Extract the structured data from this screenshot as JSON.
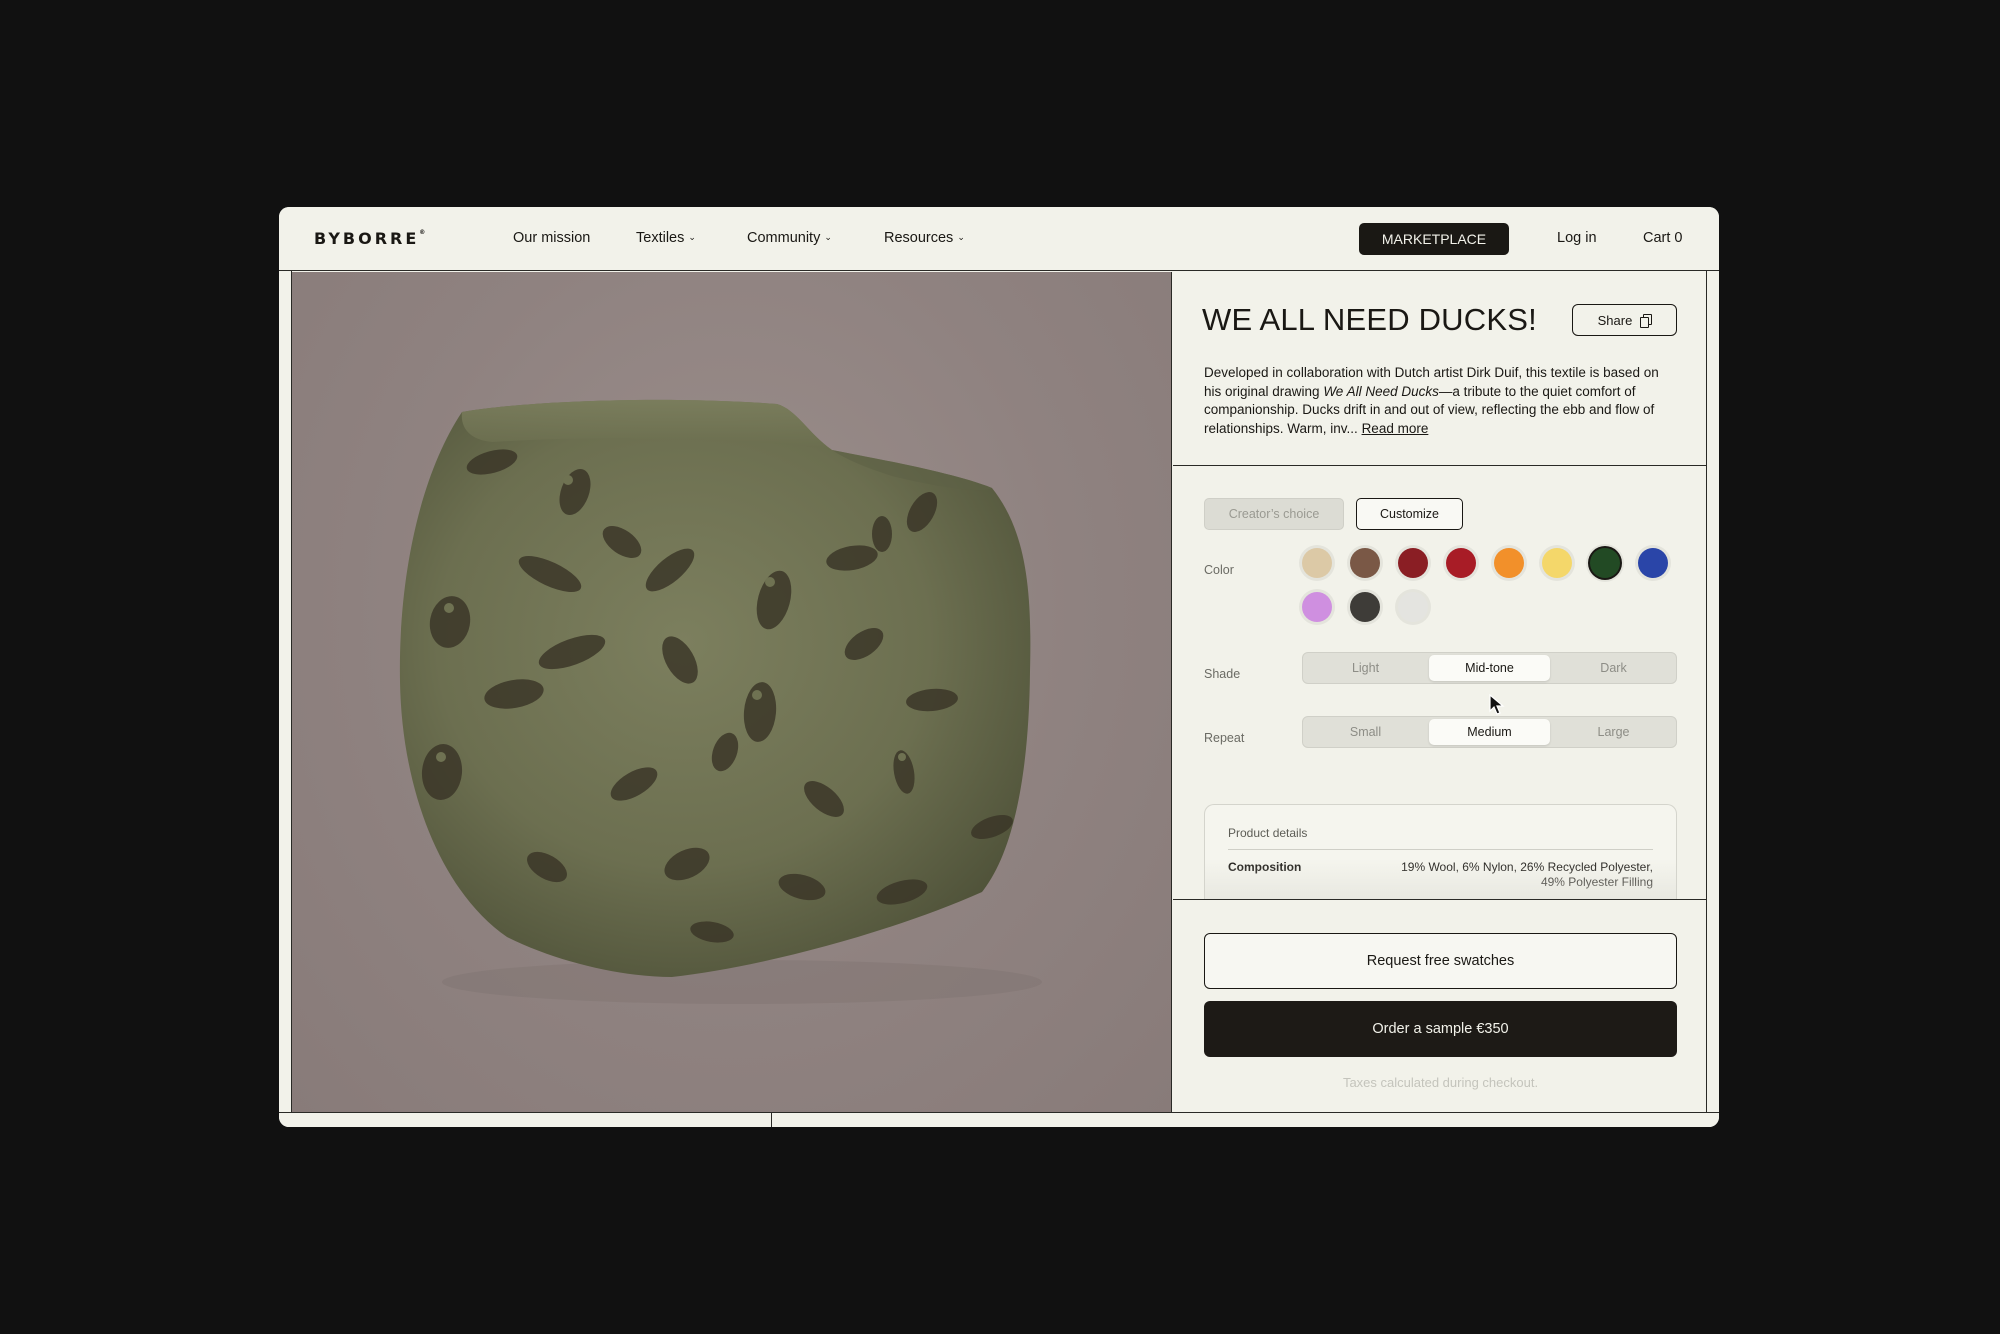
{
  "brand": {
    "logo": "BYBORRE"
  },
  "nav": {
    "items": [
      {
        "label": "Our mission",
        "dropdown": false
      },
      {
        "label": "Textiles",
        "dropdown": true
      },
      {
        "label": "Community",
        "dropdown": true
      },
      {
        "label": "Resources",
        "dropdown": true
      }
    ],
    "marketplace": "MARKETPLACE",
    "login": "Log in",
    "cart": "Cart 0"
  },
  "product": {
    "title": "WE ALL NEED DUCKS!",
    "share": "Share",
    "description_1": "Developed in collaboration with Dutch artist Dirk Duif, this textile is based on his original drawing ",
    "description_italic": "We All Need Ducks",
    "description_2": "—a tribute to the quiet comfort of companionship. Ducks drift in and out of view, reflecting the ebb and flow of relationships. Warm, inv...",
    "read_more": "Read more"
  },
  "mode": {
    "creator": "Creator’s choice",
    "customize": "Customize",
    "active": "Customize"
  },
  "color": {
    "label": "Color",
    "swatches": [
      "#dcc9a6",
      "#7a5846",
      "#8a1e24",
      "#a81c26",
      "#f2902a",
      "#f4d76a",
      "#224a24",
      "#2a45a8",
      "#cf8fe0",
      "#3e3c38",
      "#e4e4e0"
    ],
    "selected_index": 6
  },
  "shade": {
    "label": "Shade",
    "options": [
      "Light",
      "Mid-tone",
      "Dark"
    ],
    "active": "Mid-tone"
  },
  "repeat": {
    "label": "Repeat",
    "options": [
      "Small",
      "Medium",
      "Large"
    ],
    "active": "Medium"
  },
  "details": {
    "heading": "Product details",
    "composition_label": "Composition",
    "composition_line1": "19% Wool, 6% Nylon,  26% Recycled Polyester,",
    "composition_line2": "49% Polyester Filling"
  },
  "actions": {
    "swatches": "Request free swatches",
    "order": "Order a sample €350",
    "tax_note": "Taxes calculated during checkout."
  }
}
